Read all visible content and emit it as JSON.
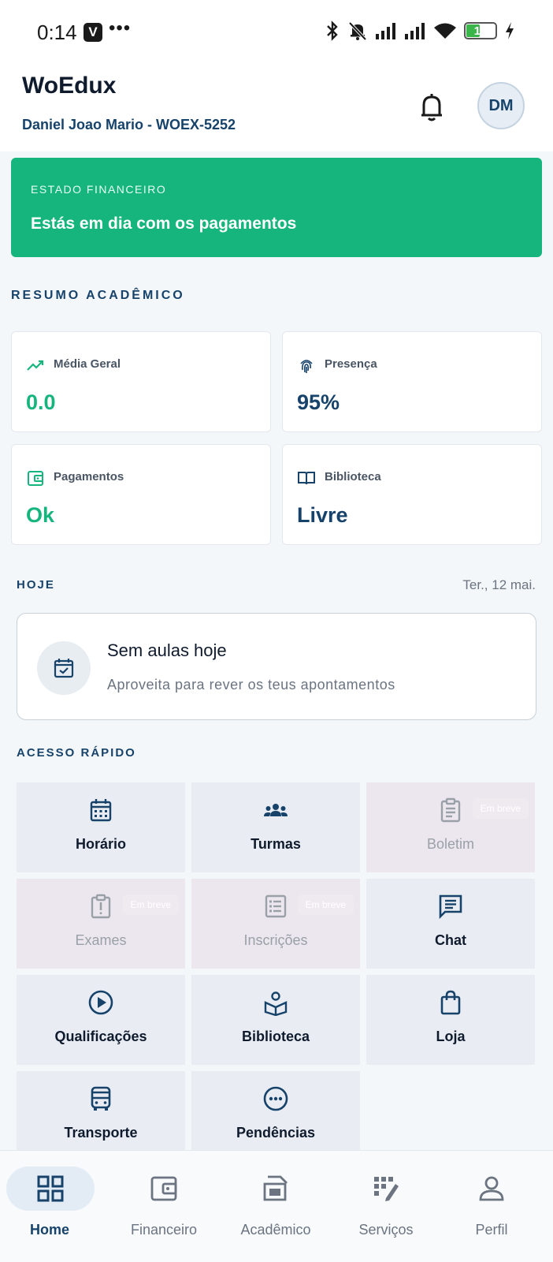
{
  "status_bar": {
    "time": "0:14",
    "app_badge": "V",
    "more": "•••",
    "battery": "12"
  },
  "header": {
    "title": "WoEdux",
    "user": "Daniel Joao Mario - WOEX-5252",
    "avatar_initials": "DM"
  },
  "finance": {
    "label": "ESTADO FINANCEIRO",
    "message": "Estás em dia com os pagamentos",
    "color": "#16b57e"
  },
  "academic_summary": {
    "title": "RESUMO ACADÊMICO",
    "cards": [
      {
        "label": "Média Geral",
        "value": "0.0",
        "icon": "trending-up-icon",
        "color": "#16b57e"
      },
      {
        "label": "Presença",
        "value": "95%",
        "icon": "fingerprint-icon",
        "color": "#17436b"
      },
      {
        "label": "Pagamentos",
        "value": "Ok",
        "icon": "wallet-icon",
        "color": "#16b57e"
      },
      {
        "label": "Biblioteca",
        "value": "Livre",
        "icon": "book-open-icon",
        "color": "#17436b"
      }
    ]
  },
  "today": {
    "title": "HOJE",
    "date": "Ter., 12 mai.",
    "card_title": "Sem aulas hoje",
    "card_subtitle": "Aproveita para rever os teus apontamentos"
  },
  "quick_access": {
    "title": "ACESSO RÁPIDO",
    "soon_label": "Em breve",
    "tiles": [
      {
        "label": "Horário",
        "icon": "calendar-icon",
        "disabled": false
      },
      {
        "label": "Turmas",
        "icon": "groups-icon",
        "disabled": false
      },
      {
        "label": "Boletim",
        "icon": "clipboard-icon",
        "disabled": true
      },
      {
        "label": "Exames",
        "icon": "alert-clipboard-icon",
        "disabled": true
      },
      {
        "label": "Inscrições",
        "icon": "list-icon",
        "disabled": true
      },
      {
        "label": "Chat",
        "icon": "chat-icon",
        "disabled": false
      },
      {
        "label": "Qualificações",
        "icon": "play-circle-icon",
        "disabled": false
      },
      {
        "label": "Biblioteca",
        "icon": "reader-icon",
        "disabled": false
      },
      {
        "label": "Loja",
        "icon": "shopping-bag-icon",
        "disabled": false
      },
      {
        "label": "Transporte",
        "icon": "bus-icon",
        "disabled": false
      },
      {
        "label": "Pendências",
        "icon": "more-circle-icon",
        "disabled": false
      }
    ]
  },
  "bottom_nav": {
    "items": [
      {
        "label": "Home",
        "icon": "grid-icon",
        "active": true
      },
      {
        "label": "Financeiro",
        "icon": "wallet-icon",
        "active": false
      },
      {
        "label": "Acadêmico",
        "icon": "school-icon",
        "active": false
      },
      {
        "label": "Serviços",
        "icon": "services-icon",
        "active": false
      },
      {
        "label": "Perfil",
        "icon": "person-icon",
        "active": false
      }
    ]
  }
}
